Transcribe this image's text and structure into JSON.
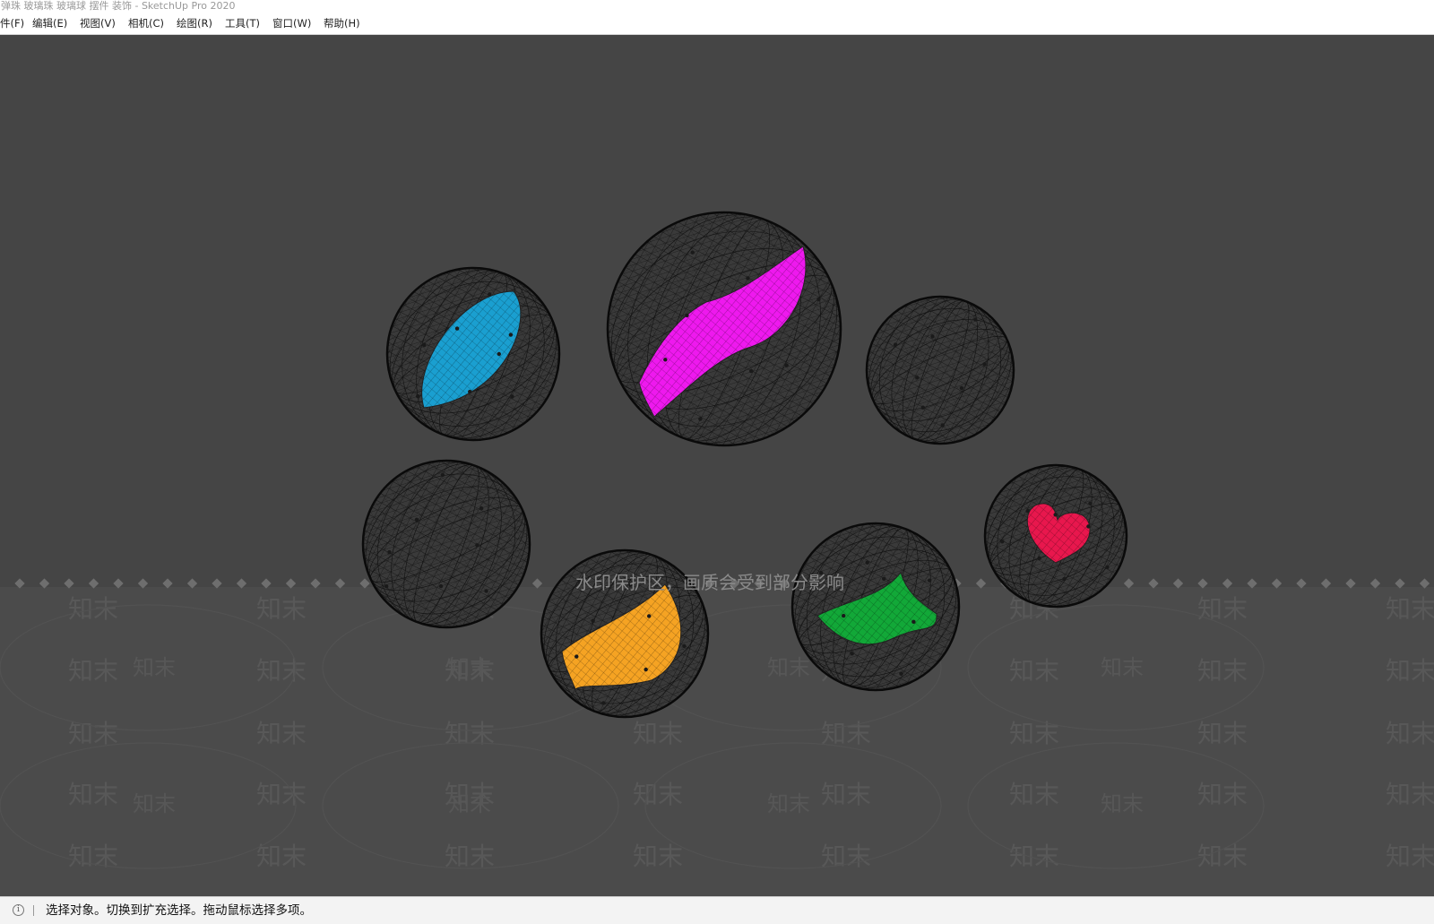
{
  "window": {
    "title": "弹珠 玻璃珠 玻璃球 摆件 装饰 - SketchUp Pro 2020"
  },
  "menu": {
    "items": [
      {
        "label": "件(F)",
        "name": "menu-file"
      },
      {
        "label": "编辑(E)",
        "name": "menu-edit"
      },
      {
        "label": "视图(V)",
        "name": "menu-view"
      },
      {
        "label": "相机(C)",
        "name": "menu-camera"
      },
      {
        "label": "绘图(R)",
        "name": "menu-draw"
      },
      {
        "label": "工具(T)",
        "name": "menu-tools"
      },
      {
        "label": "窗口(W)",
        "name": "menu-window"
      },
      {
        "label": "帮助(H)",
        "name": "menu-help"
      }
    ]
  },
  "viewport": {
    "background": "#454545",
    "watermark_notice": "水印保护区，画质会受到部分影响",
    "watermark_text": "知末",
    "marbles": [
      {
        "name": "marble-blue-leaf",
        "inner_color": "#1a9fd0",
        "inner_shape": "leaf"
      },
      {
        "name": "marble-magenta-wave",
        "inner_color": "#ee19ee",
        "inner_shape": "wave"
      },
      {
        "name": "marble-empty-right",
        "inner_color": "",
        "inner_shape": "none"
      },
      {
        "name": "marble-empty-left",
        "inner_color": "",
        "inner_shape": "none"
      },
      {
        "name": "marble-orange-leaf",
        "inner_color": "#f5a323",
        "inner_shape": "leaf"
      },
      {
        "name": "marble-green-leaf",
        "inner_color": "#12a838",
        "inner_shape": "leaf"
      },
      {
        "name": "marble-red-heart",
        "inner_color": "#e8174d",
        "inner_shape": "heart"
      }
    ]
  },
  "status": {
    "icon": "info-icon",
    "text": "选择对象。切换到扩充选择。拖动鼠标选择多项。"
  }
}
